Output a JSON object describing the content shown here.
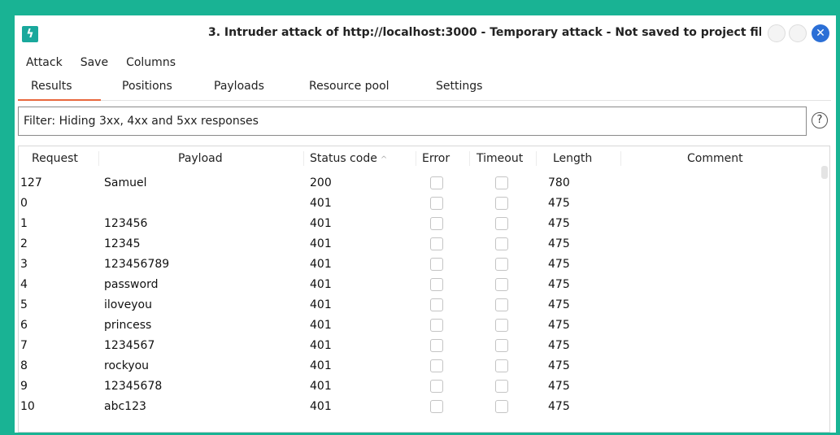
{
  "window": {
    "title": "3. Intruder attack of http://localhost:3000 - Temporary attack - Not saved to project fil",
    "icon_symbol": "ϟ",
    "close_symbol": "✕"
  },
  "menu": {
    "attack": "Attack",
    "save": "Save",
    "columns": "Columns"
  },
  "tabs": {
    "results": "Results",
    "positions": "Positions",
    "payloads": "Payloads",
    "resource_pool": "Resource pool",
    "settings": "Settings",
    "active": "results"
  },
  "filter": {
    "text": "Filter: Hiding 3xx, 4xx and 5xx responses",
    "help_symbol": "?"
  },
  "table": {
    "headers": {
      "request": "Request",
      "payload": "Payload",
      "status_code": "Status code",
      "sort_indicator": "^",
      "error": "Error",
      "timeout": "Timeout",
      "length": "Length",
      "comment": "Comment"
    },
    "rows": [
      {
        "request": "127",
        "payload": "Samuel",
        "status": "200",
        "length": "780",
        "comment": ""
      },
      {
        "request": "0",
        "payload": "",
        "status": "401",
        "length": "475",
        "comment": ""
      },
      {
        "request": "1",
        "payload": "123456",
        "status": "401",
        "length": "475",
        "comment": ""
      },
      {
        "request": "2",
        "payload": "12345",
        "status": "401",
        "length": "475",
        "comment": ""
      },
      {
        "request": "3",
        "payload": "123456789",
        "status": "401",
        "length": "475",
        "comment": ""
      },
      {
        "request": "4",
        "payload": "password",
        "status": "401",
        "length": "475",
        "comment": ""
      },
      {
        "request": "5",
        "payload": "iloveyou",
        "status": "401",
        "length": "475",
        "comment": ""
      },
      {
        "request": "6",
        "payload": "princess",
        "status": "401",
        "length": "475",
        "comment": ""
      },
      {
        "request": "7",
        "payload": "1234567",
        "status": "401",
        "length": "475",
        "comment": ""
      },
      {
        "request": "8",
        "payload": "rockyou",
        "status": "401",
        "length": "475",
        "comment": ""
      },
      {
        "request": "9",
        "payload": "12345678",
        "status": "401",
        "length": "475",
        "comment": ""
      },
      {
        "request": "10",
        "payload": "abc123",
        "status": "401",
        "length": "475",
        "comment": ""
      }
    ]
  }
}
